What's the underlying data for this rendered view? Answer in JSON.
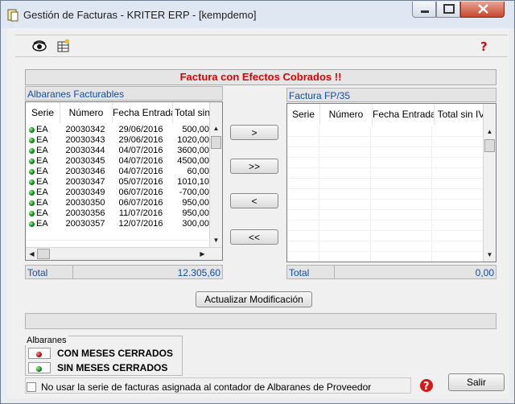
{
  "window": {
    "title": "Gestión de Facturas - KRITER ERP - [kempdemo]",
    "controls": [
      "minimize",
      "maximize",
      "close"
    ]
  },
  "toolbar": {
    "icons": [
      "eye-icon",
      "spreadsheet-icon",
      "help-icon"
    ]
  },
  "message": "Factura con Efectos Cobrados !!",
  "left_panel": {
    "title": "Albaranes Facturables",
    "columns": [
      "Serie",
      "Número",
      "Fecha Entrada",
      "Total sin"
    ],
    "rows": [
      {
        "serie": "EA",
        "numero": "20030342",
        "fecha": "29/06/2016",
        "total": "500,00"
      },
      {
        "serie": "EA",
        "numero": "20030343",
        "fecha": "29/06/2016",
        "total": "1020,00"
      },
      {
        "serie": "EA",
        "numero": "20030344",
        "fecha": "04/07/2016",
        "total": "3600,00"
      },
      {
        "serie": "EA",
        "numero": "20030345",
        "fecha": "04/07/2016",
        "total": "4500,00"
      },
      {
        "serie": "EA",
        "numero": "20030346",
        "fecha": "04/07/2016",
        "total": "60,00"
      },
      {
        "serie": "EA",
        "numero": "20030347",
        "fecha": "05/07/2016",
        "total": "1010,10"
      },
      {
        "serie": "EA",
        "numero": "20030349",
        "fecha": "06/07/2016",
        "total": "-700,00"
      },
      {
        "serie": "EA",
        "numero": "20030350",
        "fecha": "06/07/2016",
        "total": "950,00"
      },
      {
        "serie": "EA",
        "numero": "20030356",
        "fecha": "11/07/2016",
        "total": "950,00"
      },
      {
        "serie": "EA",
        "numero": "20030357",
        "fecha": "12/07/2016",
        "total": "300,00"
      }
    ],
    "total_label": "Total",
    "total_value": "12.305,60"
  },
  "transfer_buttons": [
    ">",
    ">>",
    "<",
    "<<"
  ],
  "right_panel": {
    "title": "Factura FP/35",
    "columns": [
      "Serie",
      "Número",
      "Fecha Entrada",
      "Total sin IV"
    ],
    "total_label": "Total",
    "total_value": "0,00"
  },
  "update_button": "Actualizar Modificación",
  "legend": {
    "title": "Albaranes",
    "items": [
      {
        "label": "CON MESES CERRADOS",
        "color": "#b61414"
      },
      {
        "label": "SIN MESES CERRADOS",
        "color": "#0c8a1d"
      }
    ]
  },
  "checkbox": {
    "label": "No usar la serie de facturas asignada al contador de Albaranes de Proveedor",
    "checked": false
  },
  "exit_button": "Salir"
}
